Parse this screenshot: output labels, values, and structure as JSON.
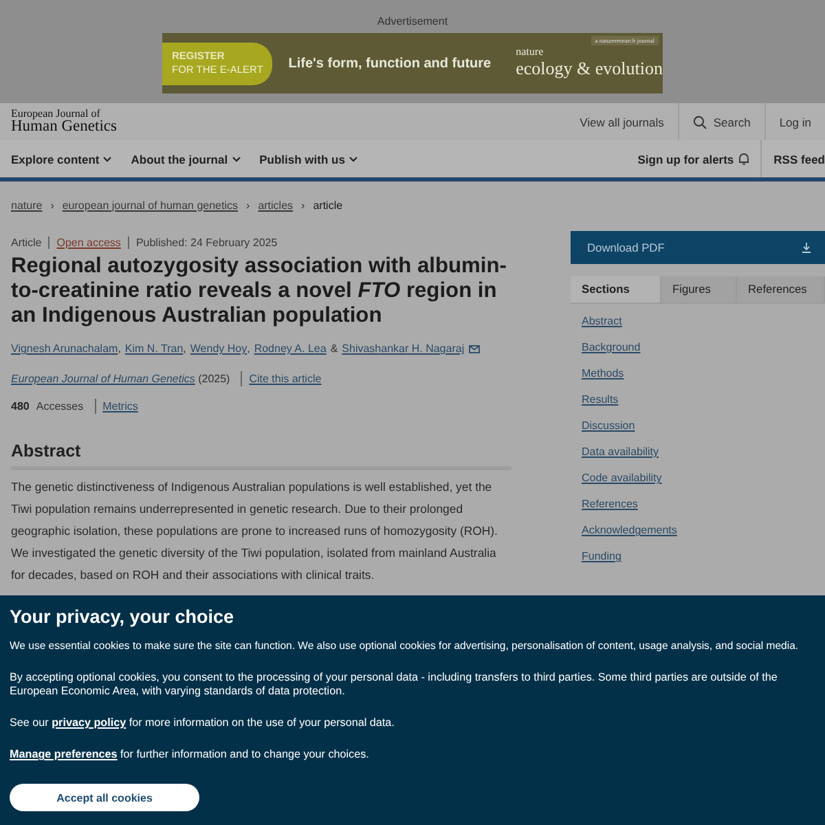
{
  "advert": {
    "label": "Advertisement",
    "cta_line1": "REGISTER",
    "cta_line2": "FOR THE E-ALERT",
    "tagline": "Life's form, function and future",
    "publisher_note": "a natureresearch journal",
    "brand_top": "nature",
    "brand_main": "ecology & evolution"
  },
  "header": {
    "logo_line1": "European Journal of",
    "logo_line2": "Human Genetics",
    "links": [
      {
        "label": "View all journals",
        "kind": "text"
      },
      {
        "label": "Search",
        "kind": "search"
      },
      {
        "label": "Log in",
        "kind": "text"
      }
    ]
  },
  "nav": {
    "left": [
      "Explore content",
      "About the journal",
      "Publish with us"
    ],
    "alerts": "Sign up for alerts",
    "rss": "RSS feed"
  },
  "breadcrumb": {
    "separator": "›",
    "items": [
      {
        "label": "nature",
        "link": true
      },
      {
        "label": "european journal of human genetics",
        "link": true
      },
      {
        "label": "articles",
        "link": true
      },
      {
        "label": "article",
        "link": false
      }
    ]
  },
  "article": {
    "type": "Article",
    "access": "Open access",
    "published": "Published: 24 February 2025",
    "title": "Regional autozygosity association with albumin-to-creatinine ratio reveals a novel *FTO* region in an Indigenous Australian population",
    "authors": [
      "Vignesh Arunachalam",
      "Kim N. Tran",
      "Wendy Hoy",
      "Rodney A. Lea",
      "Shivashankar H. Nagaraj"
    ],
    "author_separators": [
      ",",
      ",",
      ",",
      "&"
    ],
    "journal": "European Journal of Human Genetics",
    "year": "(2025)",
    "cite": "Cite this article",
    "accesses_count": "480",
    "accesses_label": "Accesses",
    "metrics": "Metrics",
    "abstract_heading": "Abstract",
    "abstract_text": "The genetic distinctiveness of Indigenous Australian populations is well established, yet the Tiwi population remains underrepresented in genetic research. Due to their prolonged geographic isolation, these populations are prone to increased runs of homozygosity (ROH). We investigated the genetic diversity of the Tiwi population, isolated from mainland Australia for decades, based on ROH and their associations with clinical traits."
  },
  "sidebar": {
    "download": "Download PDF",
    "tabs": [
      {
        "label": "Sections",
        "selected": true
      },
      {
        "label": "Figures",
        "selected": false
      },
      {
        "label": "References",
        "selected": false
      }
    ],
    "sections": [
      "Abstract",
      "Background",
      "Methods",
      "Results",
      "Discussion",
      "Data availability",
      "Code availability",
      "References",
      "Acknowledgements",
      "Funding"
    ]
  },
  "cookie_banner": {
    "title": "Your privacy, your choice",
    "para1": "We use essential cookies to make sure the site can function. We also use optional cookies for advertising, personalisation of content, usage analysis, and social media.",
    "para2": "By accepting optional cookies, you consent to the processing of your personal data - including transfers to third parties. Some third parties are outside of the European Economic Area, with varying standards of data protection.",
    "para3_before": "See our",
    "privacy_link": "privacy policy",
    "para3_after": "for more information on the use of your personal data.",
    "manage_link": "Manage preferences",
    "manage_after": "for further information and to change your choices.",
    "accept": "Accept all cookies"
  }
}
